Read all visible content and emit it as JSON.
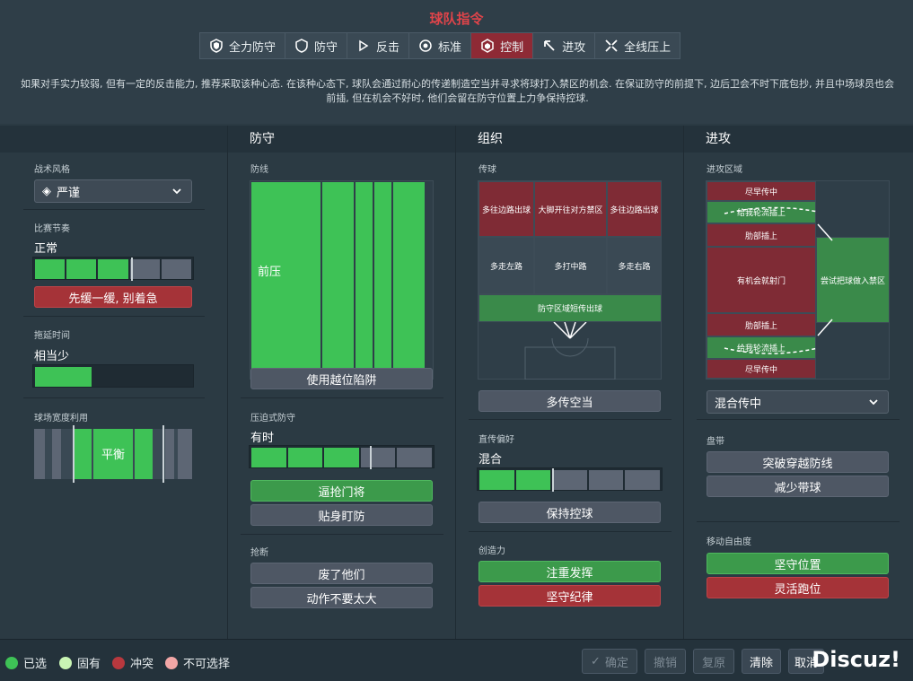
{
  "header": {
    "title": "球队指令",
    "tabs": [
      {
        "label": "全力防守",
        "icon": "shield-double-icon"
      },
      {
        "label": "防守",
        "icon": "shield-icon"
      },
      {
        "label": "反击",
        "icon": "counter-icon"
      },
      {
        "label": "标准",
        "icon": "balance-icon"
      },
      {
        "label": "控制",
        "icon": "control-icon",
        "active": true
      },
      {
        "label": "进攻",
        "icon": "attack-icon"
      },
      {
        "label": "全线压上",
        "icon": "all-out-attack-icon"
      }
    ],
    "description": "如果对手实力较弱, 但有一定的反击能力, 推荐采取该种心态. 在该种心态下, 球队会通过耐心的传递制造空当并寻求将球打入禁区的机会. 在保证防守的前提下, 边后卫会不时下底包抄, 并且中场球员也会前插, 但在机会不好时, 他们会留在防守位置上力争保持控球."
  },
  "left": {
    "style_label": "战术风格",
    "style_value": "严谨",
    "tempo_label": "比赛节奏",
    "tempo_value": "正常",
    "tempo_level": 0.61,
    "tempo_button": "先缓一缓, 别着急",
    "timewasting_label": "拖延时间",
    "timewasting_value": "相当少",
    "timewasting_level": 0.36,
    "width_label": "球场宽度利用",
    "width_value": "平衡"
  },
  "defense": {
    "header": "防守",
    "line_label": "防线",
    "line_value": "前压",
    "offside_button": "使用越位陷阱",
    "press_label": "压迫式防守",
    "press_value": "有时",
    "press_level": 0.65,
    "press_btn1": "逼抢门将",
    "press_btn2": "贴身盯防",
    "tackle_label": "抢断",
    "tackle_btn1": "废了他们",
    "tackle_btn2": "动作不要太大"
  },
  "organize": {
    "header": "组织",
    "pass_label": "传球",
    "grid": [
      "多往边路出球",
      "大脚开往对方禁区",
      "多往边路出球",
      "多走左路",
      "多打中路",
      "多走右路",
      "防守区域短传出球"
    ],
    "more_space_button": "多传空当",
    "direct_label": "直传偏好",
    "direct_value": "混合",
    "direct_level": 0.4,
    "keep_ball_button": "保持控球",
    "creative_label": "创造力",
    "creative_btn1": "注重发挥",
    "creative_btn2": "坚守纪律"
  },
  "attack": {
    "header": "进攻",
    "zone_label": "进攻区域",
    "zones": [
      "尽早传中",
      "给我轮流插上",
      "肋部插上",
      "有机会就射门",
      "尝试把球做入禁区",
      "肋部插上",
      "给我轮流插上",
      "尽早传中"
    ],
    "cross_value": "混合传中",
    "dribble_label": "盘带",
    "dribble_btn1": "突破穿越防线",
    "dribble_btn2": "减少带球",
    "freedom_label": "移动自由度",
    "freedom_btn1": "坚守位置",
    "freedom_btn2": "灵活跑位"
  },
  "footer": {
    "legend": [
      {
        "label": "已选",
        "color": "#3ec256"
      },
      {
        "label": "固有",
        "color": "#c9f5b4"
      },
      {
        "label": "冲突",
        "color": "#b8383e"
      },
      {
        "label": "不可选择",
        "color": "#f2a6a6"
      }
    ],
    "confirm": "确定",
    "undo": "撤销",
    "redo": "复原",
    "clear": "清除",
    "cancel": "取消",
    "watermark": "Discuz!"
  },
  "colors": {
    "accent_red": "#e0444a",
    "selected_green": "#3ec256",
    "active_tab": "#8e2a35"
  }
}
